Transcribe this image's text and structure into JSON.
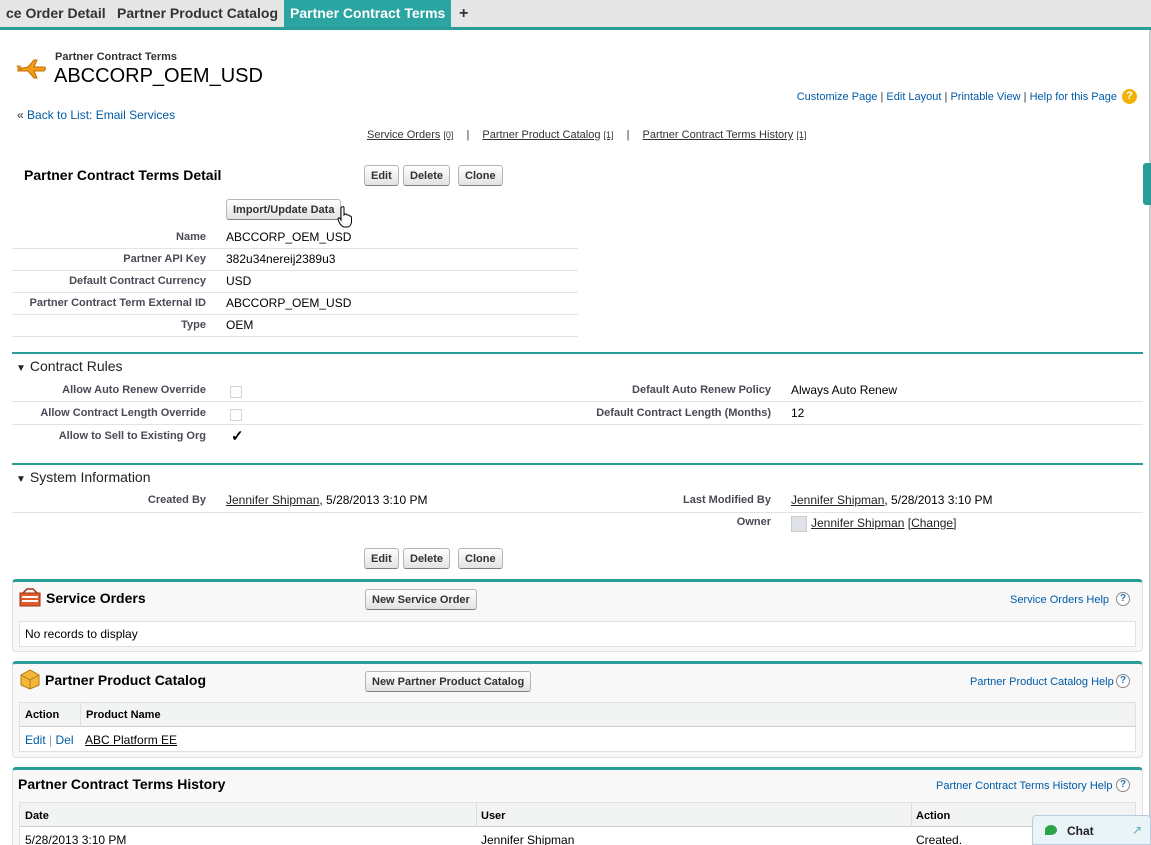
{
  "tabs": [
    {
      "label": "ce Order Detail",
      "active": false
    },
    {
      "label": "Partner Product Catalog",
      "active": false
    },
    {
      "label": "Partner Contract Terms",
      "active": true
    },
    {
      "label": "+",
      "active": false
    }
  ],
  "header": {
    "subtitle": "Partner Contract Terms",
    "title": "ABCCORP_OEM_USD",
    "icon": "airplane-icon"
  },
  "top_links": {
    "customize": "Customize Page",
    "edit_layout": "Edit Layout",
    "printable": "Printable View",
    "help": "Help for this Page",
    "sep": "|"
  },
  "back_link": {
    "prefix": "«",
    "label": "Back to List: Email Services"
  },
  "related_nav": [
    {
      "label": "Service Orders",
      "count": "[0]"
    },
    {
      "label": "Partner Product Catalog",
      "count": "[1]"
    },
    {
      "label": "Partner Contract Terms History",
      "count": "[1]"
    }
  ],
  "detail": {
    "title": "Partner Contract Terms Detail",
    "buttons": {
      "edit": "Edit",
      "delete": "Delete",
      "clone": "Clone",
      "import": "Import/Update Data"
    },
    "fields": [
      {
        "label": "Name",
        "value": "ABCCORP_OEM_USD"
      },
      {
        "label": "Partner API Key",
        "value": "382u34nereij2389u3"
      },
      {
        "label": "Default Contract Currency",
        "value": "USD"
      },
      {
        "label": "Partner Contract Term External ID",
        "value": "ABCCORP_OEM_USD"
      },
      {
        "label": "Type",
        "value": "OEM"
      }
    ]
  },
  "contract_rules": {
    "title": "Contract Rules",
    "left": [
      {
        "label": "Allow Auto Renew Override",
        "checked": false
      },
      {
        "label": "Allow Contract Length Override",
        "checked": false
      },
      {
        "label": "Allow to Sell to Existing Org",
        "checked": true
      }
    ],
    "right": [
      {
        "label": "Default Auto Renew Policy",
        "value": "Always Auto Renew"
      },
      {
        "label": "Default Contract Length (Months)",
        "value": "12"
      }
    ],
    "checkmark": "✓"
  },
  "system_info": {
    "title": "System Information",
    "created_by_label": "Created By",
    "created_by_user": "Jennifer Shipman",
    "created_by_date": ", 5/28/2013 3:10 PM",
    "modified_label": "Last Modified By",
    "modified_user": "Jennifer Shipman",
    "modified_date": ", 5/28/2013 3:10 PM",
    "owner_label": "Owner",
    "owner_user": "Jennifer Shipman",
    "owner_change": "[Change]"
  },
  "service_orders": {
    "title": "Service Orders",
    "new_button": "New Service Order",
    "help": "Service Orders Help",
    "empty": "No records to display"
  },
  "product_catalog": {
    "title": "Partner Product Catalog",
    "new_button": "New Partner Product Catalog",
    "help": "Partner Product Catalog Help",
    "columns": [
      "Action",
      "Product Name"
    ],
    "rows": [
      {
        "edit": "Edit",
        "sep": "|",
        "del": "Del",
        "product": "ABC Platform EE"
      }
    ]
  },
  "history": {
    "title": "Partner Contract Terms History",
    "help": "Partner Contract Terms History Help",
    "columns": [
      "Date",
      "User",
      "Action"
    ],
    "rows": [
      {
        "date": "5/28/2013 3:10 PM",
        "user": "Jennifer Shipman",
        "action": "Created."
      }
    ]
  },
  "chat": {
    "label": "Chat"
  },
  "help_symbol": "?",
  "colors": {
    "accent": "#2a9d9a",
    "link": "#015ba7",
    "help_orange": "#f3b100"
  }
}
